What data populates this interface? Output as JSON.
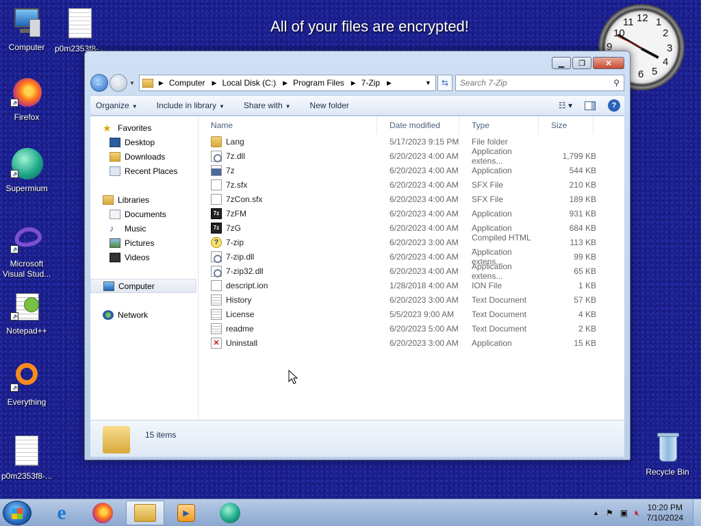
{
  "desktop": {
    "banner": "All of your files are encrypted!",
    "icons": [
      {
        "label": "Computer",
        "icon": "computer-icon"
      },
      {
        "label": "p0m2353f8-...",
        "icon": "document-icon"
      },
      {
        "label": "Firefox",
        "icon": "firefox-icon"
      },
      {
        "label": "Supermium",
        "icon": "supermium-icon"
      },
      {
        "label": "Microsoft Visual Stud...",
        "icon": "visual-studio-icon"
      },
      {
        "label": "Notepad++",
        "icon": "notepadpp-icon"
      },
      {
        "label": "Everything",
        "icon": "everything-icon"
      },
      {
        "label": "p0m2353f8-...",
        "icon": "document-icon"
      },
      {
        "label": "Recycle Bin",
        "icon": "recycle-bin-icon"
      }
    ],
    "clock_numbers": [
      "12",
      "1",
      "2",
      "3",
      "4",
      "5",
      "6",
      "9",
      "10",
      "11"
    ]
  },
  "window": {
    "title_buttons": {
      "minimize": "▁",
      "maximize": "❐",
      "close": "✕"
    },
    "address": {
      "segments": [
        "Computer",
        "Local Disk (C:)",
        "Program Files",
        "7-Zip"
      ]
    },
    "search_placeholder": "Search 7-Zip",
    "toolbar": {
      "organize": "Organize",
      "include_in_library": "Include in library",
      "share_with": "Share with",
      "new_folder": "New folder"
    },
    "nav": {
      "favorites": "Favorites",
      "desktop": "Desktop",
      "downloads": "Downloads",
      "recent_places": "Recent Places",
      "libraries": "Libraries",
      "documents": "Documents",
      "music": "Music",
      "pictures": "Pictures",
      "videos": "Videos",
      "computer": "Computer",
      "network": "Network"
    },
    "columns": {
      "name": "Name",
      "date": "Date modified",
      "type": "Type",
      "size": "Size"
    },
    "files": [
      {
        "name": "Lang",
        "date": "5/17/2023 9:15 PM",
        "type": "File folder",
        "size": "",
        "icon": "folder"
      },
      {
        "name": "7z.dll",
        "date": "6/20/2023 4:00 AM",
        "type": "Application extens...",
        "size": "1,799 KB",
        "icon": "dll"
      },
      {
        "name": "7z",
        "date": "6/20/2023 4:00 AM",
        "type": "Application",
        "size": "544 KB",
        "icon": "exe"
      },
      {
        "name": "7z.sfx",
        "date": "6/20/2023 4:00 AM",
        "type": "SFX File",
        "size": "210 KB",
        "icon": "blank"
      },
      {
        "name": "7zCon.sfx",
        "date": "6/20/2023 4:00 AM",
        "type": "SFX File",
        "size": "189 KB",
        "icon": "blank"
      },
      {
        "name": "7zFM",
        "date": "6/20/2023 4:00 AM",
        "type": "Application",
        "size": "931 KB",
        "icon": "app7z"
      },
      {
        "name": "7zG",
        "date": "6/20/2023 4:00 AM",
        "type": "Application",
        "size": "684 KB",
        "icon": "app7z"
      },
      {
        "name": "7-zip",
        "date": "6/20/2023 3:00 AM",
        "type": "Compiled HTML ...",
        "size": "113 KB",
        "icon": "help"
      },
      {
        "name": "7-zip.dll",
        "date": "6/20/2023 4:00 AM",
        "type": "Application extens...",
        "size": "99 KB",
        "icon": "dll"
      },
      {
        "name": "7-zip32.dll",
        "date": "6/20/2023 4:00 AM",
        "type": "Application extens...",
        "size": "65 KB",
        "icon": "dll"
      },
      {
        "name": "descript.ion",
        "date": "1/28/2018 4:00 AM",
        "type": "ION File",
        "size": "1 KB",
        "icon": "blank"
      },
      {
        "name": "History",
        "date": "6/20/2023 3:00 AM",
        "type": "Text Document",
        "size": "57 KB",
        "icon": "txt"
      },
      {
        "name": "License",
        "date": "5/5/2023 9:00 AM",
        "type": "Text Document",
        "size": "4 KB",
        "icon": "txt"
      },
      {
        "name": "readme",
        "date": "6/20/2023 5:00 AM",
        "type": "Text Document",
        "size": "2 KB",
        "icon": "txt"
      },
      {
        "name": "Uninstall",
        "date": "6/20/2023 3:00 AM",
        "type": "Application",
        "size": "15 KB",
        "icon": "uninst"
      }
    ],
    "status": "15 items"
  },
  "taskbar": {
    "time": "10:20 PM",
    "date": "7/10/2024"
  },
  "colors": {
    "desktop_bg": "#1b1f8c",
    "window_frame": "#b9cfe9"
  }
}
